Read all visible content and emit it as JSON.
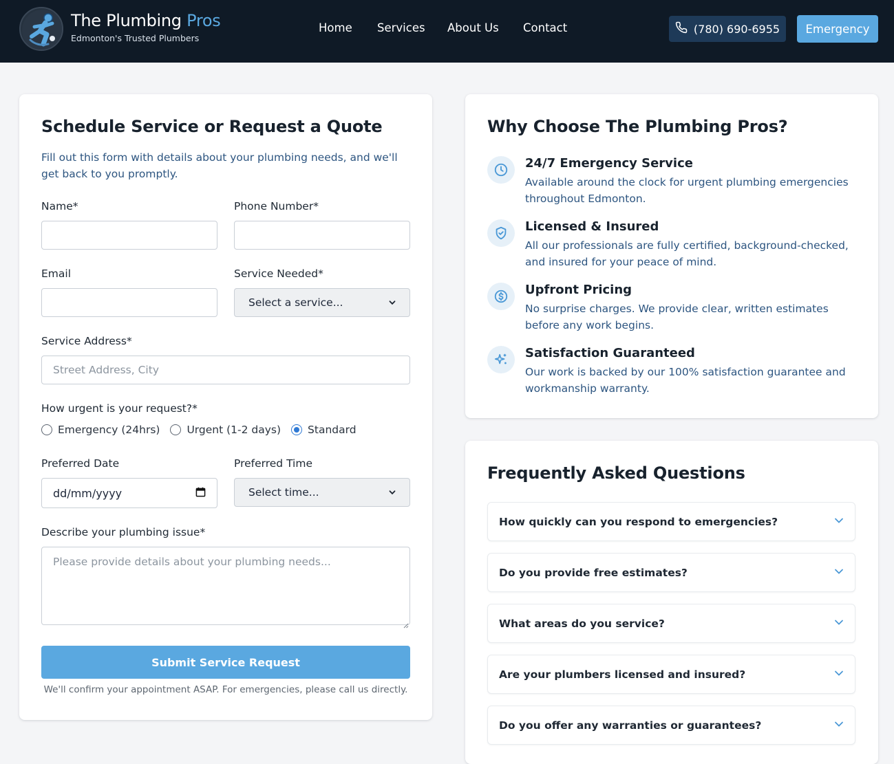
{
  "header": {
    "brand_name_part1": "The Plumbing",
    "brand_name_part2": "Pros",
    "tagline": "Edmonton's Trusted Plumbers",
    "nav": [
      "Home",
      "Services",
      "About Us",
      "Contact"
    ],
    "phone_label": "(780) 690-6955",
    "emergency_label": "Emergency",
    "colors": {
      "background": "#0f1a26",
      "accent": "#5aa8e0",
      "phone_button": "#1e3a58"
    }
  },
  "form": {
    "title": "Schedule Service or Request a Quote",
    "intro": "Fill out this form with details about your plumbing needs, and we'll get back to you promptly.",
    "name_label": "Name*",
    "name_value": "",
    "phone_label": "Phone Number*",
    "phone_value": "",
    "email_label": "Email",
    "email_value": "",
    "service_label": "Service Needed*",
    "service_selected": "Select a service...",
    "address_label": "Service Address*",
    "address_placeholder": "Street Address, City",
    "urgency_label": "How urgent is your request?*",
    "urgency_options": [
      {
        "label": "Emergency (24hrs)",
        "checked": false
      },
      {
        "label": "Urgent (1-2 days)",
        "checked": false
      },
      {
        "label": "Standard",
        "checked": true
      }
    ],
    "date_label": "Preferred Date",
    "date_value": "dd/mm/yyyy",
    "time_label": "Preferred Time",
    "time_selected": "Select time...",
    "issue_label": "Describe your plumbing issue*",
    "issue_placeholder": "Please provide details about your plumbing needs...",
    "submit_label": "Submit Service Request",
    "confirm_note": "We'll confirm your appointment ASAP. For emergencies, please call us directly."
  },
  "why": {
    "title": "Why Choose The Plumbing Pros?",
    "features": [
      {
        "icon": "clock-icon",
        "title": "24/7 Emergency Service",
        "desc": "Available around the clock for urgent plumbing emergencies throughout Edmonton."
      },
      {
        "icon": "shield-check-icon",
        "title": "Licensed & Insured",
        "desc": "All our professionals are fully certified, background-checked, and insured for your peace of mind."
      },
      {
        "icon": "dollar-circle-icon",
        "title": "Upfront Pricing",
        "desc": "No surprise charges. We provide clear, written estimates before any work begins."
      },
      {
        "icon": "sparkles-icon",
        "title": "Satisfaction Guaranteed",
        "desc": "Our work is backed by our 100% satisfaction guarantee and workmanship warranty."
      }
    ]
  },
  "faq": {
    "title": "Frequently Asked Questions",
    "items": [
      "How quickly can you respond to emergencies?",
      "Do you provide free estimates?",
      "What areas do you service?",
      "Are your plumbers licensed and insured?",
      "Do you offer any warranties or guarantees?"
    ]
  }
}
